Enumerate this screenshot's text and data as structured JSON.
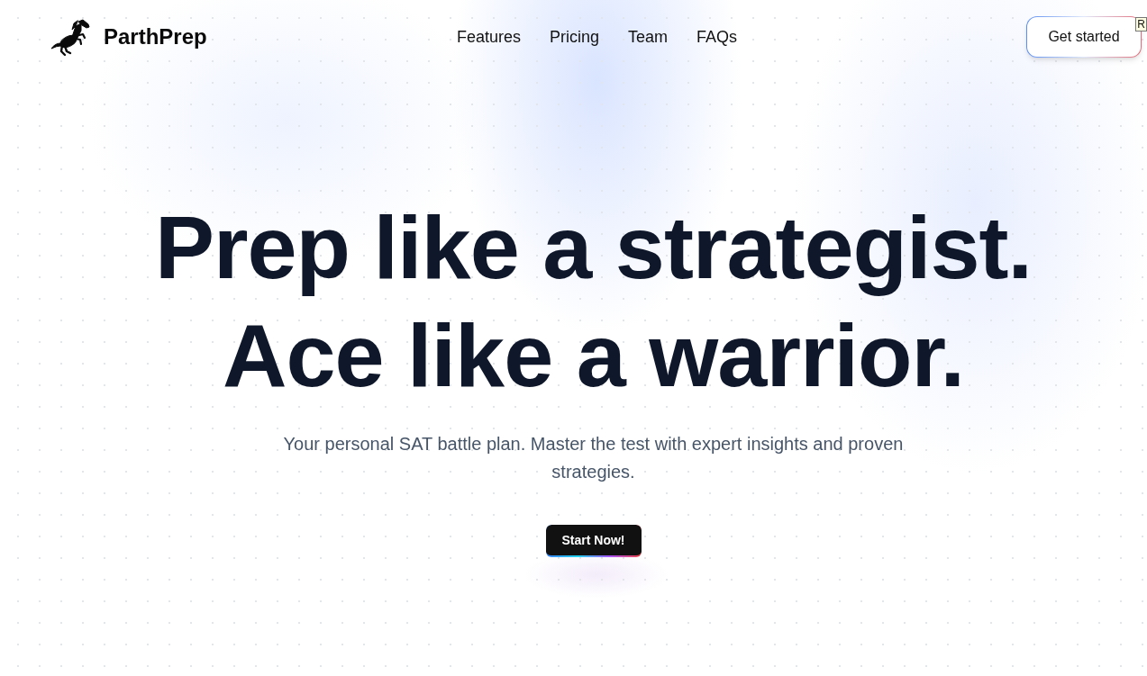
{
  "brand": {
    "name": "ParthPrep"
  },
  "nav": {
    "links": [
      {
        "label": "Features"
      },
      {
        "label": "Pricing"
      },
      {
        "label": "Team"
      },
      {
        "label": "FAQs"
      }
    ]
  },
  "cta": {
    "label": "Get started"
  },
  "tooltip": {
    "text": "R"
  },
  "hero": {
    "headline": [
      "Prep like a strategist.",
      "Ace like a warrior."
    ],
    "subtitle": "Your personal SAT battle plan. Master the test with expert insights and proven strategies.",
    "button": "Start Now!"
  }
}
